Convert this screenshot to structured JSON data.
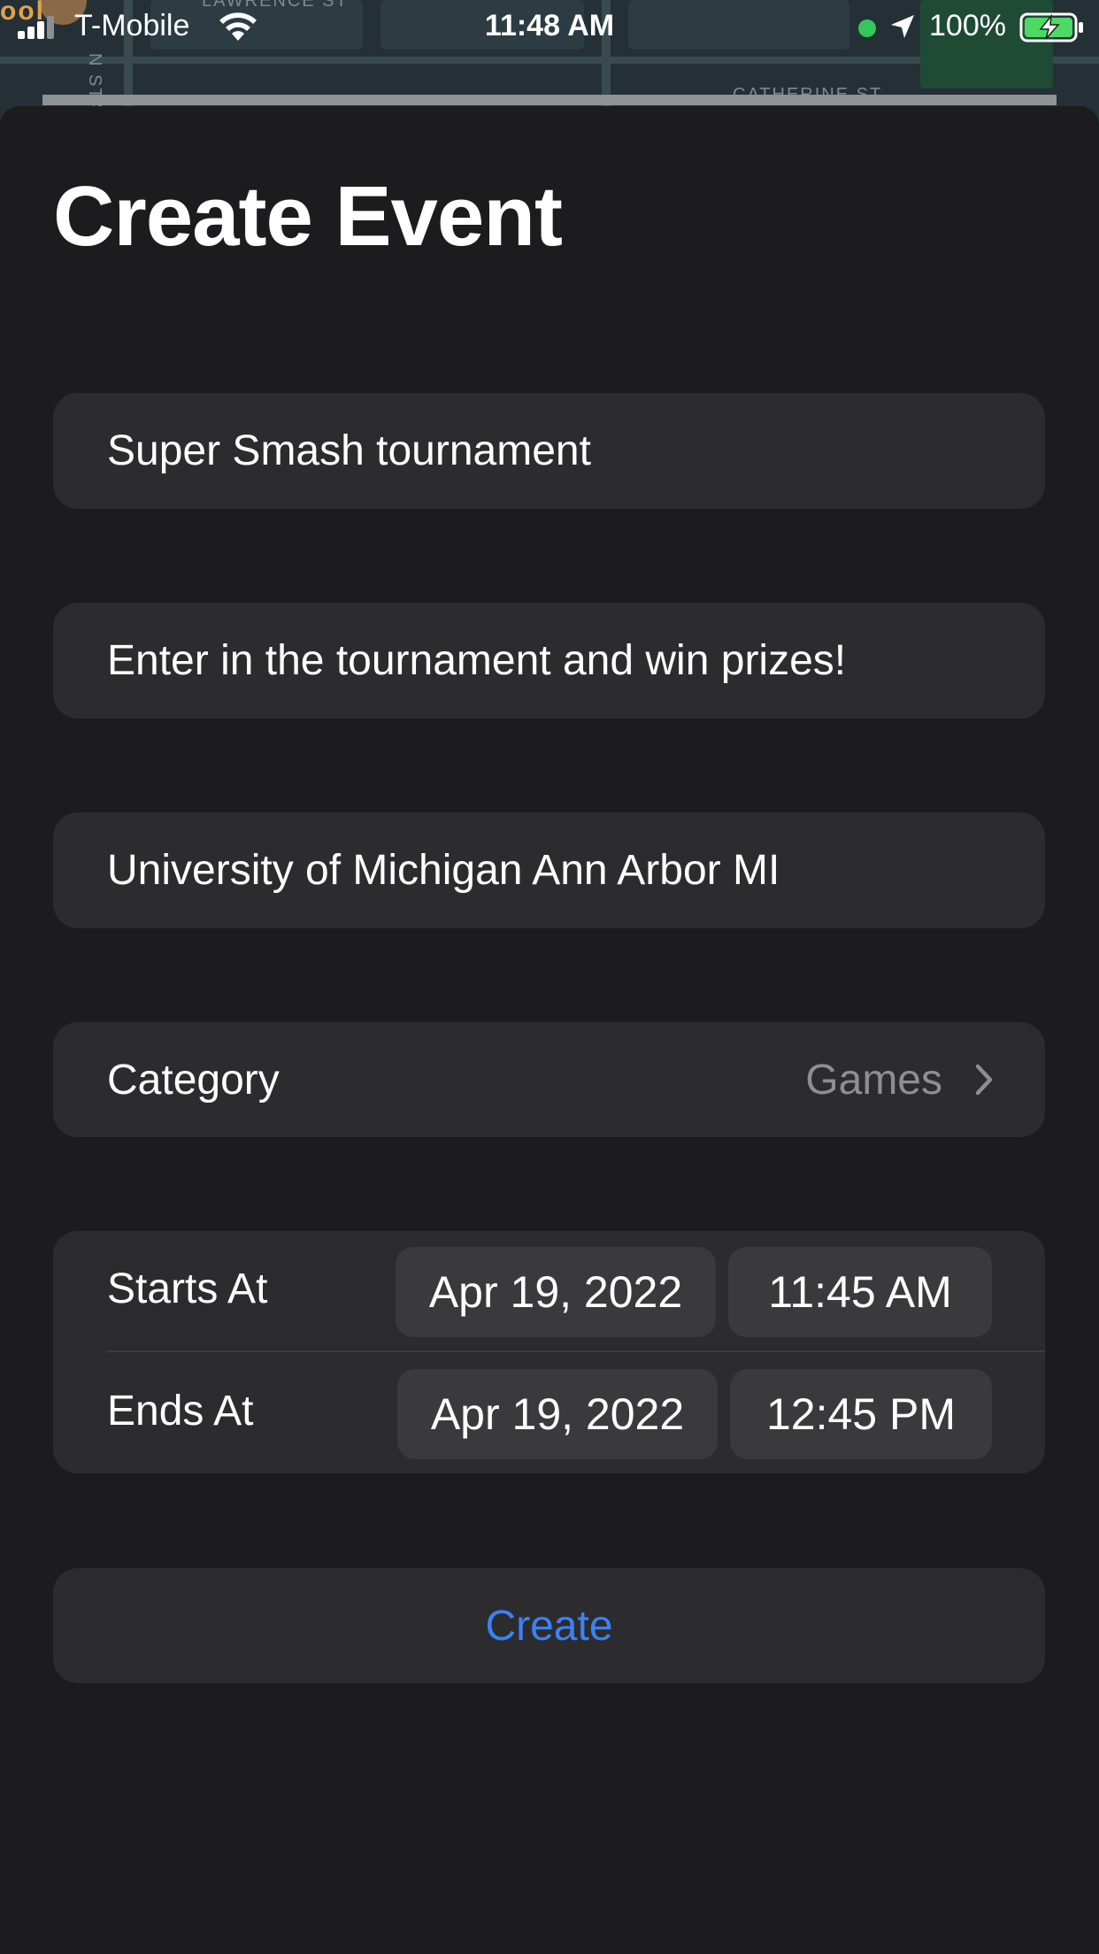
{
  "status_bar": {
    "carrier": "T-Mobile",
    "time": "11:48 AM",
    "battery_percent": "100%",
    "signal_icon": "cellular-signal-icon",
    "wifi_icon": "wifi-icon",
    "location_icon": "location-arrow-icon",
    "battery_icon": "battery-charging-icon",
    "camera_indicator_color": "#35c759"
  },
  "map": {
    "street_labels": [
      "LAWRENCE ST",
      "CATHERINE ST",
      "N STATE ST"
    ],
    "poi_partial_label": "ool"
  },
  "page": {
    "title": "Create Event"
  },
  "form": {
    "name_value": "Super Smash tournament",
    "description_value": "Enter in the tournament and win prizes!",
    "location_value": "University of Michigan Ann Arbor MI",
    "category": {
      "label": "Category",
      "value": "Games",
      "icon": "chevron-right-icon"
    },
    "starts": {
      "label": "Starts At",
      "date": "Apr 19, 2022",
      "time": "11:45 AM"
    },
    "ends": {
      "label": "Ends At",
      "date": "Apr 19, 2022",
      "time": "12:45 PM"
    },
    "create_label": "Create"
  },
  "colors": {
    "background": "#1c1c1e",
    "card": "#2c2c2e",
    "pill": "#3a3a3c",
    "accent": "#3b82f6",
    "secondary_text": "#8e8e93"
  }
}
